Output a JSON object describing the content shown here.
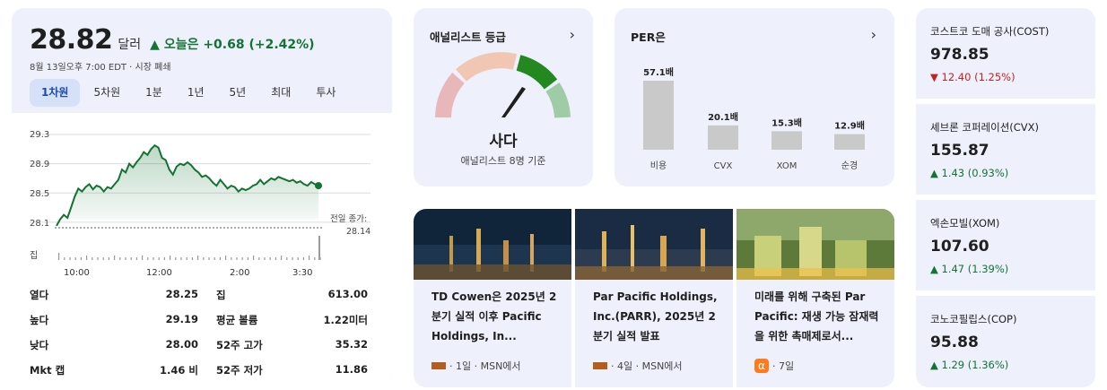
{
  "stock": {
    "price": "28.82",
    "unit": "달러",
    "change": "▲ 오늘은 +0.68 (+2.42%)",
    "subline": "8월 13일오후 7:00 EDT · 시장 폐쇄",
    "tabs": [
      "1차원",
      "5차원",
      "1분",
      "1년",
      "5년",
      "최대",
      "투사"
    ],
    "active_tab": "1차원",
    "chart": {
      "y_ticks": [
        "29.3",
        "28.9",
        "28.5",
        "28.1"
      ],
      "vol_label": "집",
      "x_ticks": [
        "10:00",
        "12:00",
        "2:00",
        "3:30"
      ],
      "prev_close_label": "전일 종가:",
      "prev_close_value": "28.14"
    },
    "stats": [
      {
        "label": "열다",
        "value": "28.25"
      },
      {
        "label": "집",
        "value": "613.00"
      },
      {
        "label": "높다",
        "value": "29.19"
      },
      {
        "label": "평균 볼륨",
        "value": "1.22미터"
      },
      {
        "label": "낮다",
        "value": "28.00"
      },
      {
        "label": "52주 고가",
        "value": "35.32"
      },
      {
        "label": "Mkt 캡",
        "value": "1.46 비"
      },
      {
        "label": "52주 저가",
        "value": "11.86"
      }
    ]
  },
  "chart_data": {
    "type": "line",
    "series": [
      {
        "values": [
          28.05,
          28.14,
          28.2,
          28.16,
          28.3,
          28.45,
          28.56,
          28.52,
          28.58,
          28.62,
          28.55,
          28.6,
          28.58,
          28.52,
          28.58,
          28.56,
          28.62,
          28.68,
          28.82,
          28.78,
          28.9,
          28.85,
          28.92,
          28.98,
          29.06,
          29.02,
          29.1,
          29.15,
          29.12,
          28.98,
          28.95,
          28.82,
          28.75,
          28.86,
          28.9,
          28.88,
          28.92,
          28.88,
          28.82,
          28.78,
          28.72,
          28.74,
          28.7,
          28.64,
          28.6,
          28.68,
          28.62,
          28.56,
          28.6,
          28.58,
          28.52,
          28.56,
          28.54,
          28.56,
          28.6,
          28.62,
          28.68,
          28.62,
          28.66,
          28.7,
          28.68,
          28.72,
          28.7,
          28.68,
          28.66,
          28.68,
          28.64,
          28.66,
          28.62,
          28.6,
          28.65,
          28.62,
          28.6
        ]
      }
    ],
    "ylim": [
      28.0,
      29.3
    ],
    "prev_close": 28.14,
    "last": 28.82
  },
  "analyst": {
    "title": "애널리스트 등급",
    "rating": "사다",
    "sub": "애널리스트 8명 기준",
    "colors": [
      "#e8b7ba",
      "#f1c7b4",
      "#22881f",
      "#9fcca7"
    ]
  },
  "per": {
    "title": "PER은",
    "bars": [
      {
        "label": "비용",
        "value": 57.1,
        "text": "57.1배"
      },
      {
        "label": "CVX",
        "value": 20.1,
        "text": "20.1배"
      },
      {
        "label": "XOM",
        "value": 15.3,
        "text": "15.3배"
      },
      {
        "label": "순경",
        "value": 12.9,
        "text": "12.9배"
      }
    ]
  },
  "news": [
    {
      "title": "TD Cowen은 2025년 2분기 실적 이후 Pacific Holdings, In...",
      "meta": "· 1일 · MSN에서"
    },
    {
      "title": "Par Pacific Holdings, Inc.(PARR), 2025년 2분기 실적 발표",
      "meta": "· 4일 · MSN에서"
    },
    {
      "title": "미래를 위해 구축된 Par Pacific: 재생 가능 잠재력을 위한 촉매제로서...",
      "meta": "· 7일",
      "alpha": "α"
    }
  ],
  "peers": [
    {
      "name": "코스트코 도매 공사(COST)",
      "price": "978.85",
      "change": "▼ 12.40 (1.25%)",
      "dir": "down"
    },
    {
      "name": "셰브론 코퍼레이션(CVX)",
      "price": "155.87",
      "change": "▲ 1.43 (0.93%)",
      "dir": "up"
    },
    {
      "name": "엑손모빌(XOM)",
      "price": "107.60",
      "change": "▲ 1.47 (1.39%)",
      "dir": "up"
    },
    {
      "name": "코노코필립스(COP)",
      "price": "95.88",
      "change": "▲ 1.29 (1.36%)",
      "dir": "up"
    }
  ]
}
